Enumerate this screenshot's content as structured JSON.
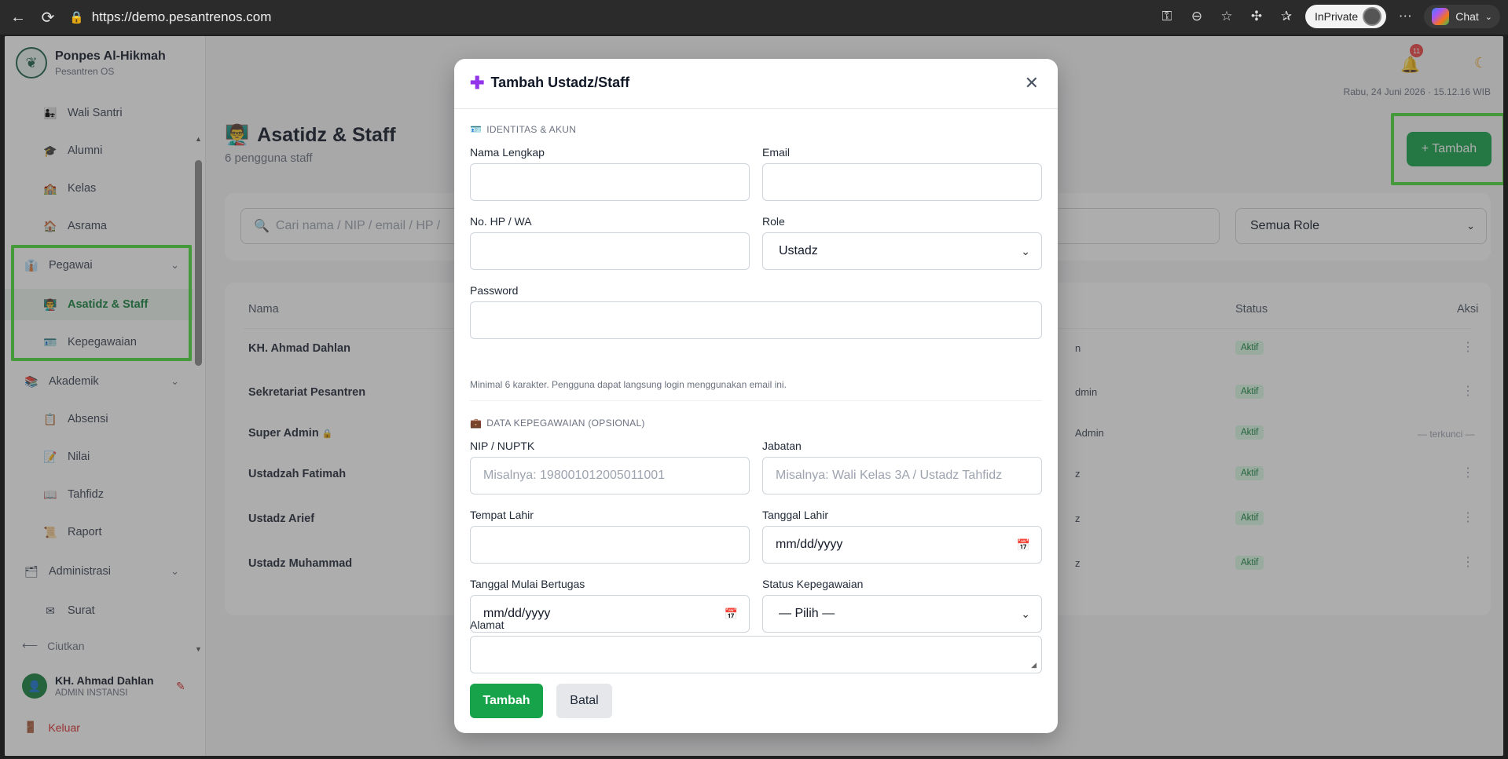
{
  "browser": {
    "url": "https://demo.pesantrenos.com",
    "inprivate_label": "InPrivate",
    "chat_label": "Chat"
  },
  "sidebar": {
    "brand_name": "Ponpes Al-Hikmah",
    "brand_sub": "Pesantren OS",
    "items": [
      {
        "label": "Wali Santri",
        "icon": "👨‍👧"
      },
      {
        "label": "Alumni",
        "icon": "🎓"
      },
      {
        "label": "Kelas",
        "icon": "🏫"
      },
      {
        "label": "Asrama",
        "icon": "🏠"
      },
      {
        "label": "Pegawai",
        "icon": "👔"
      },
      {
        "label": "Asatidz & Staff",
        "icon": "👨‍🏫"
      },
      {
        "label": "Kepegawaian",
        "icon": "🪪"
      },
      {
        "label": "Akademik",
        "icon": "📚"
      },
      {
        "label": "Absensi",
        "icon": "📋"
      },
      {
        "label": "Nilai",
        "icon": "📝"
      },
      {
        "label": "Tahfidz",
        "icon": "📖"
      },
      {
        "label": "Raport",
        "icon": "📜"
      },
      {
        "label": "Administrasi",
        "icon": "🗂"
      },
      {
        "label": "Surat",
        "icon": "✉"
      }
    ],
    "collapse_label": "Ciutkan",
    "user_name": "KH. Ahmad Dahlan",
    "user_role": "ADMIN INSTANSI",
    "logout_label": "Keluar"
  },
  "topbar": {
    "notification_count": "11",
    "datetime": "Rabu, 24 Juni 2026 · 15.12.16 WIB"
  },
  "page": {
    "title": "Asatidz & Staff",
    "title_icon": "👨‍🏫",
    "subtitle": "6 pengguna staff",
    "add_button": "+ Tambah",
    "search_placeholder": "Cari nama / NIP / email / HP /",
    "role_filter": "Semua Role"
  },
  "table": {
    "headers": {
      "name": "Nama",
      "status": "Status",
      "actions": "Aksi"
    },
    "rows": [
      {
        "name": "KH. Ahmad Dahlan",
        "role": "n",
        "status": "Aktif"
      },
      {
        "name": "Sekretariat Pesantren",
        "role": "dmin",
        "status": "Aktif"
      },
      {
        "name": "Super Admin",
        "role": "Admin",
        "status": "Aktif",
        "locked": "— terkunci —"
      },
      {
        "name": "Ustadzah Fatimah",
        "role": "z",
        "status": "Aktif"
      },
      {
        "name": "Ustadz Arief",
        "role": "z",
        "status": "Aktif"
      },
      {
        "name": "Ustadz Muhammad",
        "role": "z",
        "status": "Aktif"
      }
    ]
  },
  "modal": {
    "title": "Tambah Ustadz/Staff",
    "section_identity": "IDENTITAS & AKUN",
    "section_employment": "DATA KEPEGAWAIAN (OPSIONAL)",
    "fields": {
      "full_name": {
        "label": "Nama Lengkap",
        "value": ""
      },
      "email": {
        "label": "Email",
        "value": ""
      },
      "phone": {
        "label": "No. HP / WA",
        "value": ""
      },
      "role": {
        "label": "Role",
        "value": "Ustadz"
      },
      "password": {
        "label": "Password",
        "value": "",
        "hint": "Minimal 6 karakter. Pengguna dapat langsung login menggunakan email ini."
      },
      "nip": {
        "label": "NIP / NUPTK",
        "placeholder": "Misalnya: 198001012005011001"
      },
      "position": {
        "label": "Jabatan",
        "placeholder": "Misalnya: Wali Kelas 3A / Ustadz Tahfidz"
      },
      "birth_place": {
        "label": "Tempat Lahir",
        "value": ""
      },
      "birth_date": {
        "label": "Tanggal Lahir",
        "value": "mm/dd/yyyy"
      },
      "start_date": {
        "label": "Tanggal Mulai Bertugas",
        "value": "mm/dd/yyyy"
      },
      "employment_status": {
        "label": "Status Kepegawaian",
        "value": "— Pilih —"
      },
      "address": {
        "label": "Alamat",
        "value": ""
      }
    },
    "submit_label": "Tambah",
    "cancel_label": "Batal"
  }
}
